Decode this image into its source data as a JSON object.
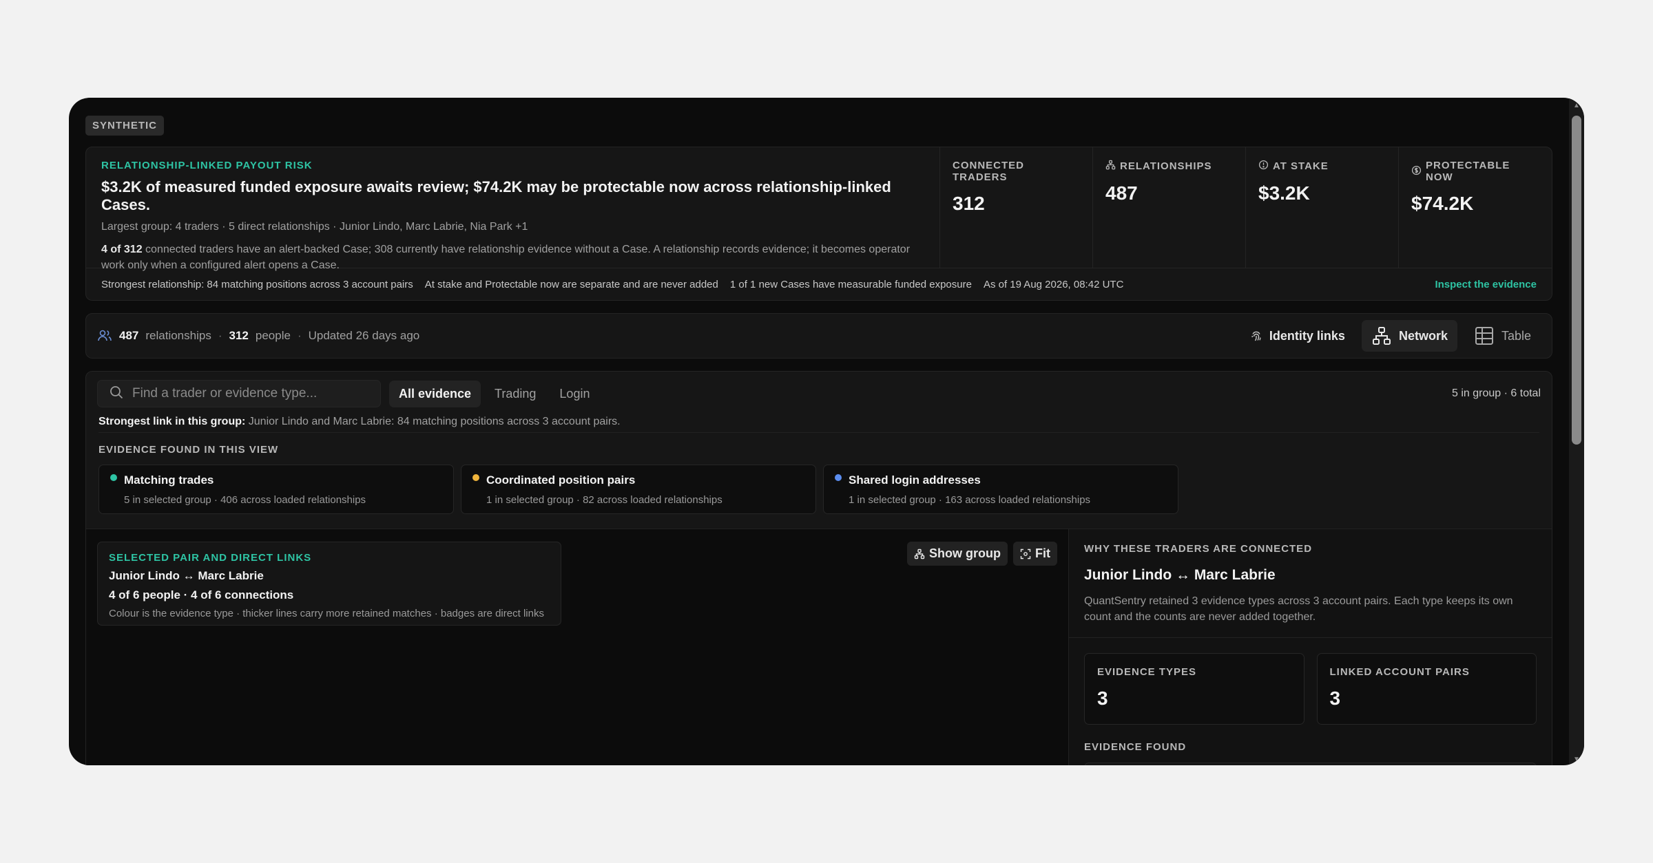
{
  "badge": "SYNTHETIC",
  "hero": {
    "eyebrow": "RELATIONSHIP-LINKED PAYOUT RISK",
    "headline": "$3.2K of measured funded exposure awaits review; $74.2K may be protectable now across relationship-linked Cases.",
    "sub": "Largest group: 4 traders · 5 direct relationships · Junior Lindo, Marc Labrie, Nia Park +1",
    "desc_bold": "4 of 312",
    "desc_rest": " connected traders have an alert-backed Case; 308 currently have relationship evidence without a Case. A relationship records evidence; it becomes operator work only when a configured alert opens a Case.",
    "metrics": [
      {
        "label": "CONNECTED TRADERS",
        "value": "312",
        "icon": ""
      },
      {
        "label": "RELATIONSHIPS",
        "value": "487",
        "icon": "relationships-icon"
      },
      {
        "label": "AT STAKE",
        "value": "$3.2K",
        "icon": "clock-icon"
      },
      {
        "label": "PROTECTABLE NOW",
        "value": "$74.2K",
        "icon": "dollar-icon"
      }
    ],
    "footer": {
      "strongest": "Strongest relationship: 84 matching positions across 3 account pairs",
      "separate": "At stake and Protectable now are separate and are never added",
      "new_cases": "1 of 1 new Cases have measurable funded exposure",
      "as_of": "As of 19 Aug 2026, 08:42 UTC",
      "inspect": "Inspect the evidence"
    }
  },
  "summary": {
    "relationships_count": "487",
    "relationships_label": "relationships",
    "sep1": "·",
    "people_count": "312",
    "people_label": "people",
    "sep2": "·",
    "updated": "Updated 26 days ago",
    "views": {
      "identity": "Identity links",
      "network": "Network",
      "table": "Table"
    }
  },
  "explorer": {
    "search_placeholder": "Find a trader or evidence type...",
    "filters": [
      "All evidence",
      "Trading",
      "Login"
    ],
    "group_count": "5 in group · 6 total",
    "strongest_label": "Strongest link in this group:",
    "strongest_text": " Junior Lindo and Marc Labrie: 84 matching positions across 3 account pairs.",
    "evidence_section": "EVIDENCE FOUND IN THIS VIEW",
    "evidence": [
      {
        "title": "Matching trades",
        "sub": "5 in selected group · 406 across loaded relationships",
        "color": "#2ec4a4"
      },
      {
        "title": "Coordinated position pairs",
        "sub": "1 in selected group · 82 across loaded relationships",
        "color": "#f0b43c"
      },
      {
        "title": "Shared login addresses",
        "sub": "1 in selected group · 163 across loaded relationships",
        "color": "#5b8def"
      }
    ],
    "pair_card": {
      "eyebrow": "SELECTED PAIR AND DIRECT LINKS",
      "title": "Junior Lindo ↔ Marc Labrie",
      "counts": "4 of 6 people · 4 of 6 connections",
      "legend": "Colour is the evidence type · thicker lines carry more retained matches · badges are direct links"
    },
    "controls": {
      "show_group": "Show group",
      "fit": "Fit"
    },
    "detail": {
      "eyebrow": "WHY THESE TRADERS ARE CONNECTED",
      "title": "Junior Lindo ↔ Marc Labrie",
      "desc": "QuantSentry retained 3 evidence types across 3 account pairs. Each type keeps its own count and the counts are never added together.",
      "stats": [
        {
          "label": "EVIDENCE TYPES",
          "value": "3"
        },
        {
          "label": "LINKED ACCOUNT PAIRS",
          "value": "3"
        }
      ],
      "evidence_found": "EVIDENCE FOUND"
    }
  }
}
